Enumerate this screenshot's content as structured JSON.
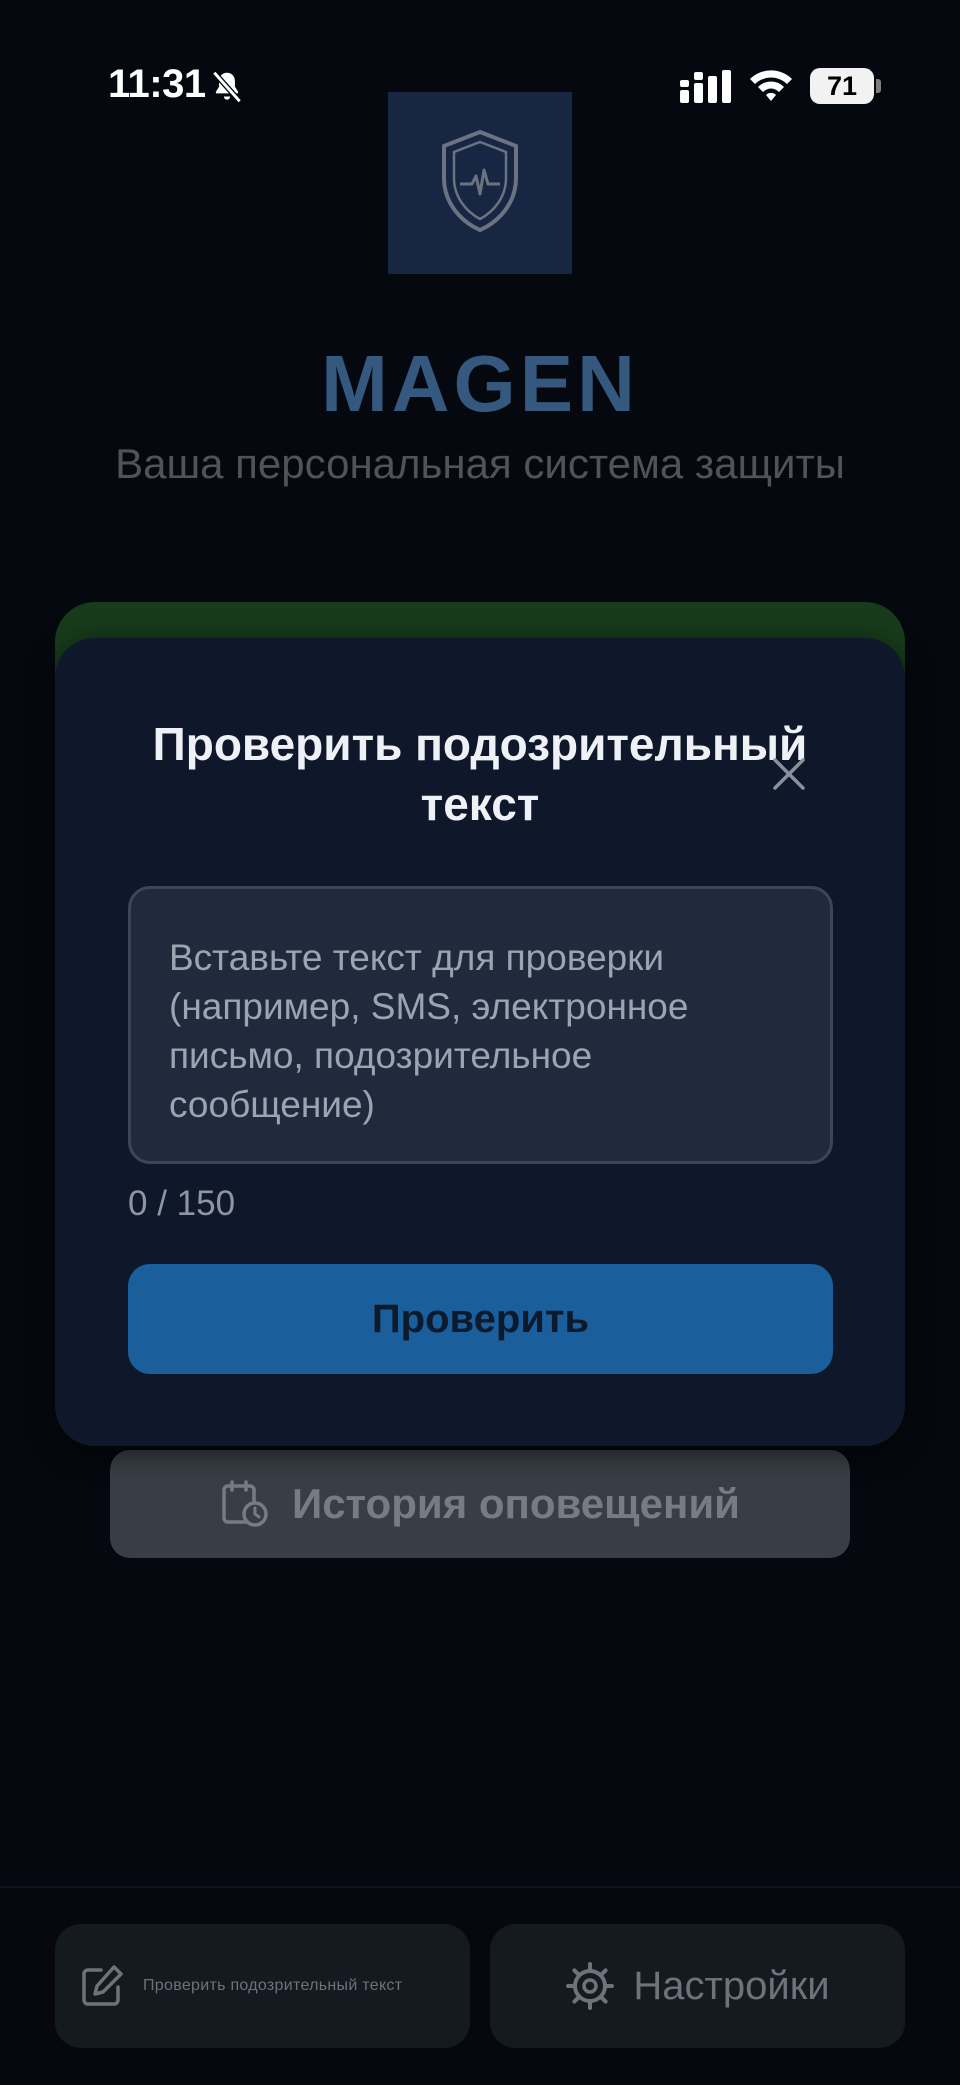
{
  "status_bar": {
    "time": "11:31",
    "battery": "71",
    "icons": [
      "bell-slash-icon",
      "cellular-signal-icon",
      "wifi-icon",
      "battery-icon"
    ]
  },
  "header": {
    "logo_icon": "shield-pulse-icon",
    "title": "MAGEN",
    "subtitle": "Ваша персональная система защиты"
  },
  "modal": {
    "title": "Проверить подозрительный текст",
    "close_icon": "close-icon",
    "input_placeholder": "Вставьте текст для проверки (например, SMS, электронное письмо, подозрительное сообщение)",
    "input_value": "",
    "counter": "0 / 150",
    "submit_label": "Проверить"
  },
  "history_button": {
    "icon": "calendar-clock-icon",
    "label": "История оповещений"
  },
  "bottom_bar": {
    "check_tab": {
      "icon": "edit-icon",
      "label": "Проверить подозрительный текст"
    },
    "settings_tab": {
      "icon": "gear-icon",
      "label": "Настройки"
    }
  },
  "colors": {
    "background": "#05080f",
    "modal": "#0f182b",
    "accent_button": "#1a5e9c",
    "title_blue": "#35597e",
    "green_card": "#183c1b"
  }
}
